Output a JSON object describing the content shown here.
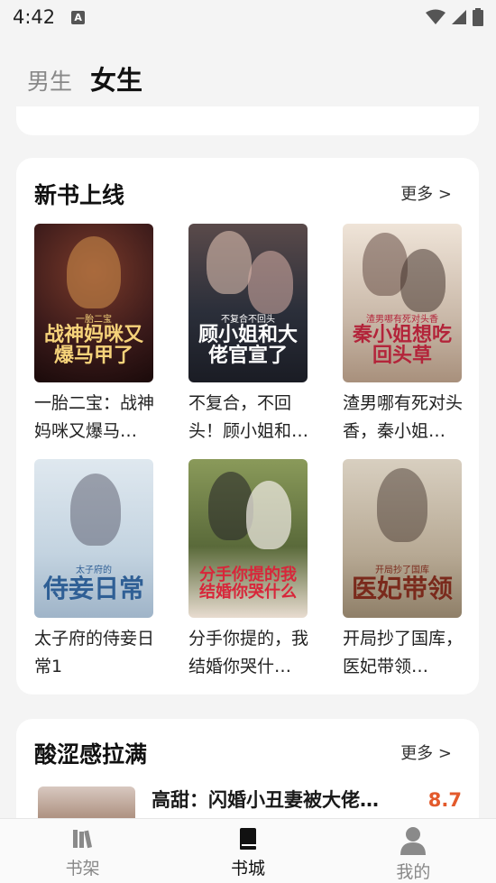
{
  "status_bar": {
    "time": "4:42",
    "badge": "A"
  },
  "gender_tabs": [
    {
      "label": "男生",
      "active": false
    },
    {
      "label": "女生",
      "active": true
    }
  ],
  "new_books": {
    "title": "新书上线",
    "more": "更多 >",
    "books": [
      {
        "title": "一胎二宝：战神妈咪又爆马…",
        "cover_text": "战神妈咪又爆马甲了",
        "cover_sub": "一胎二宝",
        "cover_color": "#3a1a1a",
        "text_color": "#f6d37a"
      },
      {
        "title": "不复合，不回头！顾小姐和…",
        "cover_text": "顾小姐和大佬官宣了",
        "cover_sub": "不复合不回头",
        "cover_color": "#2b2f3a",
        "text_color": "#ffffff"
      },
      {
        "title": "渣男哪有死对头香，秦小姐…",
        "cover_text": "秦小姐想吃回头草",
        "cover_sub": "渣男哪有死对头香",
        "cover_color": "#c9b8a8",
        "text_color": "#b3243a"
      },
      {
        "title": "太子府的侍妾日常1",
        "cover_text": "侍妾日常",
        "cover_sub": "太子府的",
        "cover_color": "#c3d3e0",
        "text_color": "#2f5f95"
      },
      {
        "title": "分手你提的，我结婚你哭什…",
        "cover_text": "分手你提的我结婚你哭什么",
        "cover_sub": "",
        "cover_color": "#5a6a3a",
        "text_color": "#d8263a"
      },
      {
        "title": "开局抄了国库，医妃带领…",
        "cover_text": "医妃带领",
        "cover_sub": "开局抄了国库",
        "cover_color": "#b7a994",
        "text_color": "#7a2a1c"
      }
    ]
  },
  "sour_section": {
    "title": "酸涩感拉满",
    "more": "更多 >",
    "first_item": {
      "title": "高甜：闪婚小丑妻被大佬…",
      "score": "8.7"
    }
  },
  "bottom_nav": [
    {
      "label": "书架",
      "icon": "bookshelf-icon",
      "active": false
    },
    {
      "label": "书城",
      "icon": "book-icon",
      "active": true
    },
    {
      "label": "我的",
      "icon": "user-icon",
      "active": false
    }
  ]
}
